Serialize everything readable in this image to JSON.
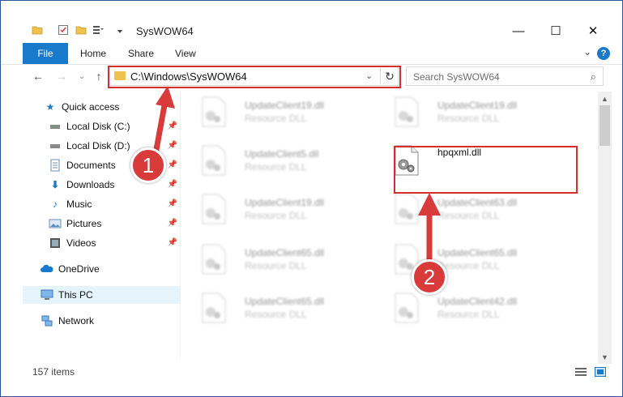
{
  "window": {
    "title": "SysWOW64",
    "minimize_label": "—",
    "maximize_label": "☐",
    "close_label": "✕"
  },
  "ribbon": {
    "tabs": [
      "File",
      "Home",
      "Share",
      "View"
    ],
    "help_label": "?"
  },
  "address_bar": {
    "path": "C:\\Windows\\SysWOW64",
    "refresh_label": "↻"
  },
  "search": {
    "placeholder": "Search SysWOW64"
  },
  "nav_pane": {
    "items": [
      {
        "label": "Quick access",
        "icon": "star-icon"
      },
      {
        "label": "Local Disk (C:)",
        "icon": "drive-icon"
      },
      {
        "label": "Local Disk (D:)",
        "icon": "drive-icon"
      },
      {
        "label": "Documents",
        "icon": "document-icon"
      },
      {
        "label": "Downloads",
        "icon": "download-icon"
      },
      {
        "label": "Music",
        "icon": "music-icon"
      },
      {
        "label": "Pictures",
        "icon": "pictures-icon"
      },
      {
        "label": "Videos",
        "icon": "videos-icon"
      },
      {
        "label": "OneDrive",
        "icon": "cloud-icon"
      },
      {
        "label": "This PC",
        "icon": "computer-icon"
      },
      {
        "label": "Network",
        "icon": "network-icon"
      }
    ]
  },
  "files": [
    {
      "name": "UpdateClient19.dll",
      "type": "Resource DLL"
    },
    {
      "name": "UpdateClient19.dll",
      "type": "Resource DLL"
    },
    {
      "name": "UpdateClient5.dll",
      "type": "Resource DLL"
    },
    {
      "name": "hpqxml.dll",
      "type": ""
    },
    {
      "name": "UpdateClient19.dll",
      "type": "Resource DLL"
    },
    {
      "name": "UpdateClient63.dll",
      "type": "Resource DLL"
    },
    {
      "name": "UpdateClient65.dll",
      "type": "Resource DLL"
    },
    {
      "name": "UpdateClient65.dll",
      "type": "Resource DLL"
    },
    {
      "name": "UpdateClient65.dll",
      "type": "Resource DLL"
    },
    {
      "name": "UpdateClient42.dll",
      "type": "Resource DLL"
    }
  ],
  "status_bar": {
    "item_count": "157 items"
  },
  "callouts": [
    "1",
    "2"
  ],
  "colors": {
    "accent": "#1979ca",
    "highlight_red": "#d92d2d",
    "selected_nav": "#e5f3fb"
  }
}
